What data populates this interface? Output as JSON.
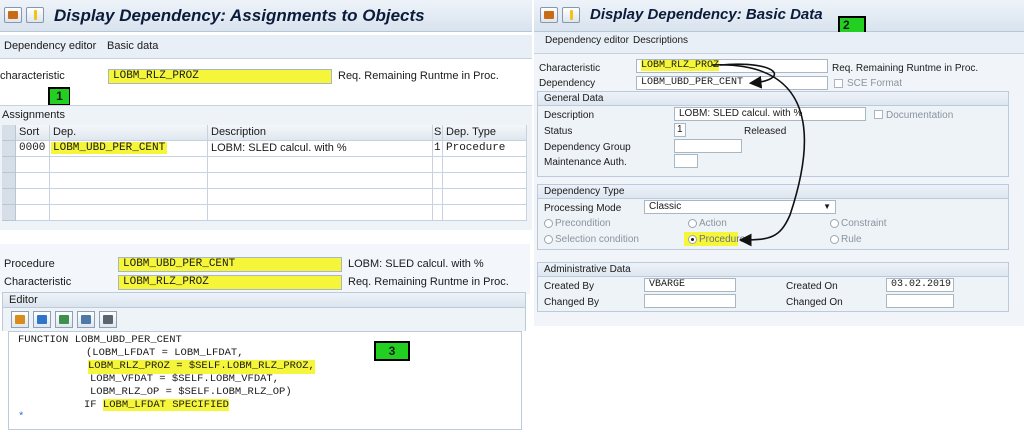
{
  "left": {
    "title": "Display Dependency: Assignments to Objects",
    "menu": [
      "Dependency editor",
      "Basic data"
    ],
    "characteristic_label": "characteristic",
    "characteristic_value": "LOBM_RLZ_PROZ",
    "characteristic_desc": "Req. Remaining Runtme in Proc.",
    "badge": "1",
    "assignments_label": "Assignments",
    "table": {
      "headers": [
        "Sort",
        "Dep.",
        "Description",
        "S",
        "Dep. Type"
      ],
      "rows": [
        {
          "sort": "0000",
          "dep": "LOBM_UBD_PER_CENT",
          "desc": "LOBM: SLED calcul. with %",
          "s": "1",
          "type": "Procedure"
        }
      ]
    },
    "procedure": {
      "procedure_label": "Procedure",
      "procedure_value": "LOBM_UBD_PER_CENT",
      "procedure_desc": "LOBM: SLED calcul. with %",
      "characteristic_label": "Characteristic",
      "characteristic_value": "LOBM_RLZ_PROZ",
      "characteristic_desc": "Req. Remaining Runtme in Proc."
    },
    "editor": {
      "label": "Editor",
      "badge": "3",
      "code": {
        "line1": "FUNCTION LOBM_UBD_PER_CENT",
        "line2": "(LOBM_LFDAT = LOBM_LFDAT,",
        "line3": "LOBM_RLZ_PROZ = $SELF.LOBM_RLZ_PROZ,",
        "line4": "LOBM_VFDAT = $SELF.LOBM_VFDAT,",
        "line5": "LOBM_RLZ_OP = $SELF.LOBM_RLZ_OP)",
        "line6_kw": "IF",
        "line6_rest": "LOBM_LFDAT SPECIFIED",
        "line7": "*"
      }
    }
  },
  "right": {
    "title": "Display Dependency: Basic Data",
    "badge": "2",
    "menu": [
      "Dependency editor",
      "Descriptions"
    ],
    "characteristic_label": "Characteristic",
    "characteristic_value": "LOBM_RLZ_PROZ",
    "characteristic_desc": "Req. Remaining Runtme in Proc.",
    "dependency_label": "Dependency",
    "dependency_value": "LOBM_UBD_PER_CENT",
    "sce_format": "SCE Format",
    "general": {
      "header": "General Data",
      "description_label": "Description",
      "description_value": "LOBM: SLED calcul. with %",
      "documentation": "Documentation",
      "status_label": "Status",
      "status_value": "1",
      "status_text": "Released",
      "dep_group_label": "Dependency Group",
      "maint_auth_label": "Maintenance Auth."
    },
    "dep_type": {
      "header": "Dependency Type",
      "processing_mode_label": "Processing Mode",
      "processing_mode_value": "Classic",
      "options": {
        "precondition": "Precondition",
        "action": "Action",
        "constraint": "Constraint",
        "selection_condition": "Selection condition",
        "procedure": "Procedure",
        "rule": "Rule"
      },
      "selected": "procedure"
    },
    "admin": {
      "header": "Administrative Data",
      "created_by_label": "Created By",
      "created_by_value": "VBARGE",
      "created_on_label": "Created On",
      "created_on_value": "03.02.2019",
      "changed_by_label": "Changed By",
      "changed_on_label": "Changed On"
    }
  },
  "colors": {
    "highlight": "#f5f53a",
    "badge": "#22d022",
    "panel": "#eef3f8"
  }
}
